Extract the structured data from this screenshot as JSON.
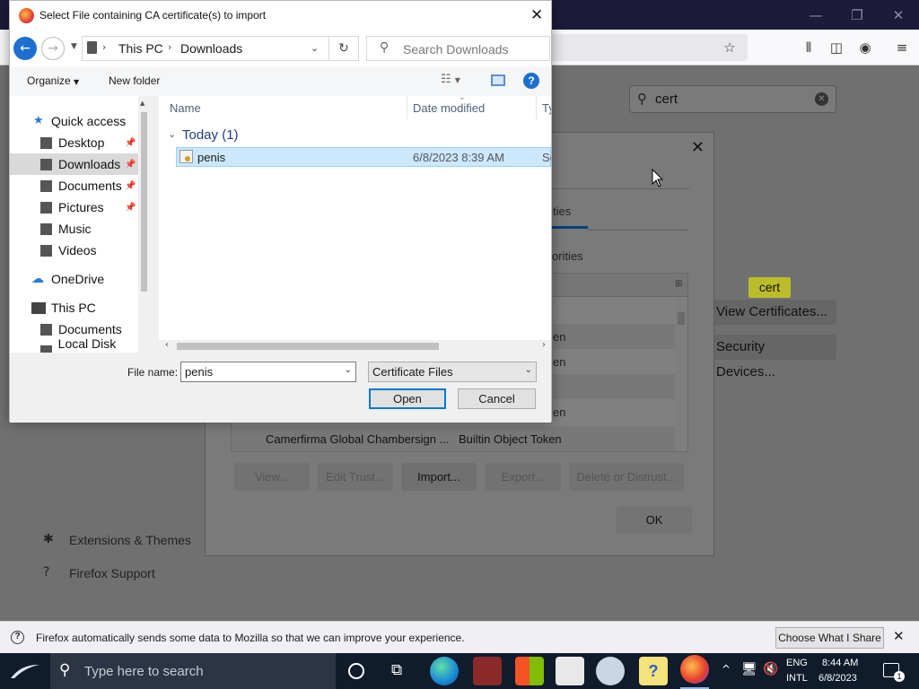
{
  "firefox": {
    "window_controls": {
      "minimize": "—",
      "restore": "❐",
      "close": "✕"
    },
    "toolbar_icons": [
      "star-icon",
      "library-icon",
      "sidebar-icon",
      "account-icon",
      "menu-icon"
    ],
    "settings_search": {
      "value": "cert"
    },
    "highlight_tooltip": "cert",
    "view_certificates_button": "View Certificates...",
    "security_devices_button": "Security Devices...",
    "footer_links": [
      "Extensions & Themes",
      "Firefox Support"
    ]
  },
  "cert_manager": {
    "tab_fragment": "ties",
    "section_fragment": "orities",
    "rows": [
      {
        "col2": ""
      },
      {
        "col2": "en"
      },
      {
        "col2": "en"
      },
      {
        "col2": ""
      },
      {
        "col2": "en"
      },
      {
        "col1": "Camerfirma Global Chambersign ...",
        "col2": "Builtin Object Token"
      }
    ],
    "buttons": {
      "view": "View...",
      "edit_trust": "Edit Trust...",
      "import": "Import...",
      "export": "Export...",
      "delete": "Delete or Distrust...",
      "ok": "OK"
    }
  },
  "file_dialog": {
    "title": "Select File containing CA certificate(s) to import",
    "address": {
      "part1": "This PC",
      "part2": "Downloads"
    },
    "search_placeholder": "Search Downloads",
    "organize": "Organize",
    "new_folder": "New folder",
    "nav": {
      "quick_access": "Quick access",
      "desktop": "Desktop",
      "downloads": "Downloads",
      "documents": "Documents",
      "pictures": "Pictures",
      "music": "Music",
      "videos": "Videos",
      "onedrive": "OneDrive",
      "this_pc": "This PC",
      "pc_documents": "Documents",
      "local_disk": "Local Disk (C:)"
    },
    "columns": {
      "name": "Name",
      "date": "Date modified",
      "type": "Typ"
    },
    "group": "Today (1)",
    "file": {
      "name": "penis",
      "date": "6/8/2023 8:39 AM",
      "type": "Sec"
    },
    "file_name_label": "File name:",
    "file_name_value": "penis",
    "filter": "Certificate Files",
    "open": "Open",
    "cancel": "Cancel"
  },
  "notification": {
    "text": "Firefox automatically sends some data to Mozilla so that we can improve your experience.",
    "button": "Choose What I Share"
  },
  "taskbar": {
    "search_placeholder": "Type here to search",
    "lang1": "ENG",
    "lang2": "INTL",
    "time": "8:44 AM",
    "date": "6/8/2023",
    "notif_count": "1"
  }
}
